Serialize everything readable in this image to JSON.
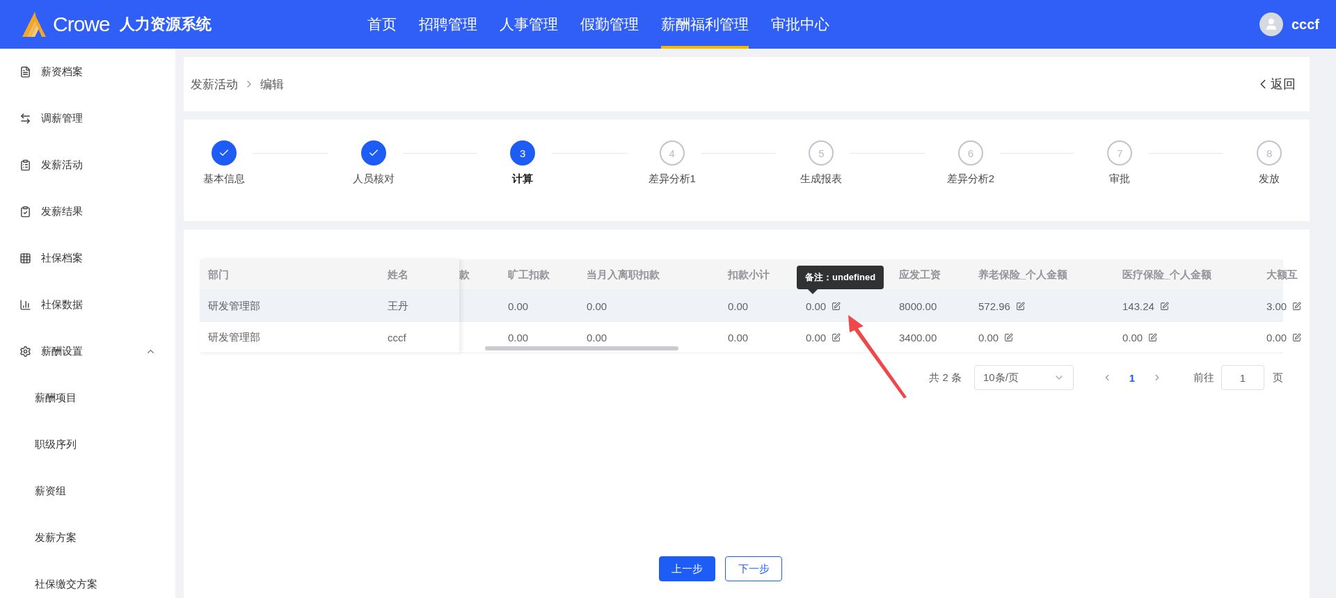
{
  "header": {
    "brand": "Crowe",
    "system": "人力资源系统",
    "nav": [
      {
        "label": "首页",
        "selected": false
      },
      {
        "label": "招聘管理",
        "selected": false
      },
      {
        "label": "人事管理",
        "selected": false
      },
      {
        "label": "假勤管理",
        "selected": false
      },
      {
        "label": "薪酬福利管理",
        "selected": true
      },
      {
        "label": "审批中心",
        "selected": false
      }
    ],
    "user": "cccf"
  },
  "sidebar": {
    "items": [
      {
        "label": "薪资档案"
      },
      {
        "label": "调薪管理"
      },
      {
        "label": "发薪活动"
      },
      {
        "label": "发薪结果"
      },
      {
        "label": "社保档案"
      },
      {
        "label": "社保数据"
      },
      {
        "label": "薪酬设置",
        "expanded": true,
        "children": [
          {
            "label": "薪酬项目"
          },
          {
            "label": "职级序列"
          },
          {
            "label": "薪资组"
          },
          {
            "label": "发薪方案"
          },
          {
            "label": "社保缴交方案"
          }
        ]
      }
    ]
  },
  "breadcrumb": [
    "发薪活动",
    "编辑"
  ],
  "back": "返回",
  "steps": [
    {
      "label": "基本信息",
      "done": true,
      "selected": false
    },
    {
      "label": "人员核对",
      "done": true,
      "selected": false
    },
    {
      "label": "计算",
      "number": "3",
      "done": false,
      "selected": true
    },
    {
      "label": "差异分析1",
      "number": "4",
      "done": false,
      "selected": false
    },
    {
      "label": "生成报表",
      "number": "5",
      "done": false,
      "selected": false
    },
    {
      "label": "差异分析2",
      "number": "6",
      "done": false,
      "selected": false
    },
    {
      "label": "审批",
      "number": "7",
      "done": false,
      "selected": false
    },
    {
      "label": "发放",
      "number": "8",
      "done": false,
      "selected": false
    }
  ],
  "table": {
    "fixed_columns": [
      "部门",
      "姓名"
    ],
    "columns": [
      {
        "label": "款"
      },
      {
        "label": "旷工扣款"
      },
      {
        "label": "当月入离职扣款"
      },
      {
        "label": "扣款小计"
      },
      {
        "tooltip": "备注：undefined"
      },
      {
        "label": "应发工资"
      },
      {
        "label": "养老保险_个人金额"
      },
      {
        "label": "医疗保险_个人金额"
      },
      {
        "label": "大额互"
      }
    ],
    "rows": [
      {
        "hovered": true,
        "fixed": [
          "研发管理部",
          "王丹"
        ],
        "cells": [
          {},
          {
            "value": "0.00"
          },
          {
            "value": "0.00"
          },
          {
            "value": "0.00"
          },
          {
            "value": "0.00",
            "editable": true
          },
          {
            "value": "8000.00"
          },
          {
            "value": "572.96",
            "editable": true
          },
          {
            "value": "143.24",
            "editable": true
          },
          {
            "value": "3.00",
            "editable": true
          }
        ]
      },
      {
        "hovered": false,
        "fixed": [
          "研发管理部",
          "cccf"
        ],
        "cells": [
          {},
          {
            "value": "0.00"
          },
          {
            "value": "0.00"
          },
          {
            "value": "0.00"
          },
          {
            "value": "0.00",
            "editable": true
          },
          {
            "value": "3400.00"
          },
          {
            "value": "0.00",
            "editable": true
          },
          {
            "value": "0.00",
            "editable": true
          },
          {
            "value": "0.00",
            "editable": true
          }
        ]
      }
    ]
  },
  "pagination": {
    "total": "共 2 条",
    "page_size": "10条/页",
    "current": "1",
    "goto_label": "前往",
    "goto_value": "1",
    "page_unit": "页"
  },
  "buttons": {
    "prev": "上一步",
    "next": "下一步"
  }
}
